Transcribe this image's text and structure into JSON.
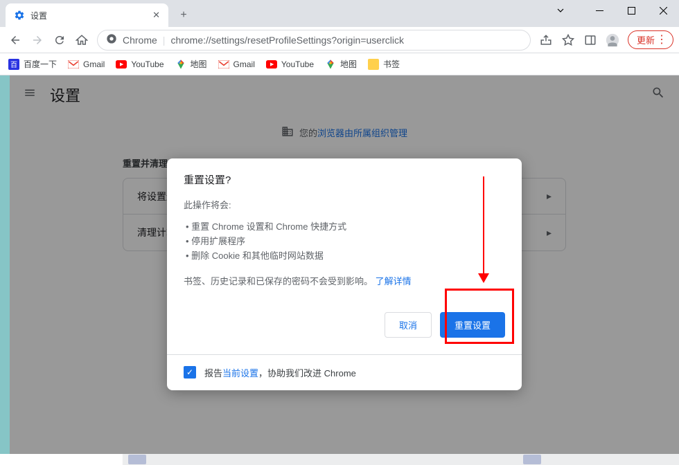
{
  "window": {
    "tab_title": "设置",
    "url_prefix": "Chrome",
    "url": "chrome://settings/resetProfileSettings?origin=userclick",
    "update_label": "更新"
  },
  "bookmarks": [
    {
      "label": "百度一下",
      "color": "#2932e1",
      "glyph": "百"
    },
    {
      "label": "Gmail",
      "color": "#ea4335",
      "glyph": "M"
    },
    {
      "label": "YouTube",
      "color": "#ff0000",
      "glyph": "▶"
    },
    {
      "label": "地图",
      "color": "#34a853",
      "glyph": "◆"
    },
    {
      "label": "Gmail",
      "color": "#ea4335",
      "glyph": "M"
    },
    {
      "label": "YouTube",
      "color": "#ff0000",
      "glyph": "▶"
    },
    {
      "label": "地图",
      "color": "#34a853",
      "glyph": "◆"
    },
    {
      "label": "书签",
      "color": "#ffd04c",
      "glyph": ""
    }
  ],
  "settings": {
    "page_title": "设置",
    "org_notice_prefix": "您的",
    "org_notice_link": "浏览器由所属组织管理",
    "section_title": "重置并清理",
    "rows": [
      {
        "label": "将设置还原为原始默认设置"
      },
      {
        "label": "清理计算机"
      }
    ]
  },
  "modal": {
    "title": "重置设置?",
    "intro": "此操作将会:",
    "bullets": [
      "重置 Chrome 设置和 Chrome 快捷方式",
      "停用扩展程序",
      "删除 Cookie 和其他临时网站数据"
    ],
    "note_prefix": "书签、历史记录和已保存的密码不会受到影响。",
    "note_link": "了解详情",
    "cancel_label": "取消",
    "confirm_label": "重置设置",
    "footer_prefix": "报告",
    "footer_link": "当前设置",
    "footer_suffix": "，协助我们改进 Chrome"
  }
}
